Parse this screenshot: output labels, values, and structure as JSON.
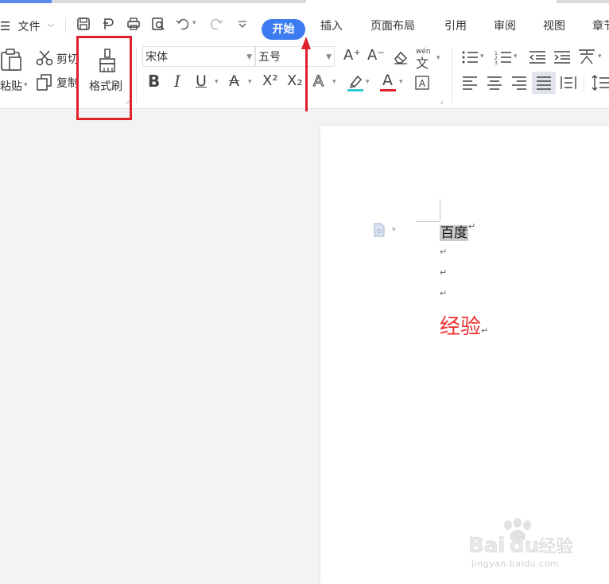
{
  "menubar": {
    "file_label": "文件",
    "tabs": [
      "开始",
      "插入",
      "页面布局",
      "引用",
      "审阅",
      "视图",
      "章节"
    ]
  },
  "ribbon": {
    "paste_label": "粘贴",
    "cut_label": "剪切",
    "copy_label": "复制",
    "format_painter_label": "格式刷",
    "font_name": "宋体",
    "font_size": "五号",
    "bold_glyph": "B",
    "italic_glyph": "I",
    "underline_glyph": "U",
    "text_glyph": "A",
    "superscript_glyph": "X²",
    "subscript_glyph": "X₂",
    "grow_glyph": "A⁺",
    "shrink_glyph": "A⁻",
    "phonetic_glyph": "wén"
  },
  "document": {
    "lines": [
      "百度",
      "",
      "",
      "",
      "经验"
    ],
    "return_mark": "↵"
  },
  "watermark": {
    "brand": "Bai du 经验",
    "url": "jingyan.baidu.com"
  },
  "colors": {
    "accent": "#3d7cf0",
    "highlight_red": "#e0202a",
    "highlight_cyan": "#34c8d8",
    "doc_red": "#ee3030"
  }
}
